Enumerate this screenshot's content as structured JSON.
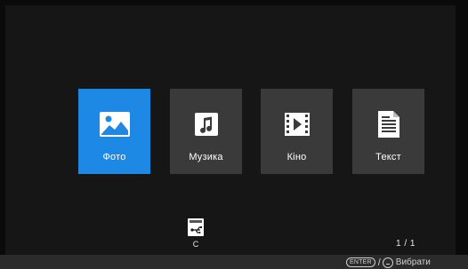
{
  "menu": {
    "items": [
      {
        "label": "Фото",
        "icon": "photo-icon",
        "selected": true
      },
      {
        "label": "Музика",
        "icon": "music-note-icon",
        "selected": false
      },
      {
        "label": "Кіно",
        "icon": "film-play-icon",
        "selected": false
      },
      {
        "label": "Текст",
        "icon": "document-text-icon",
        "selected": false
      }
    ]
  },
  "device": {
    "label": "C",
    "icon": "usb-drive-icon"
  },
  "pager": {
    "text": "1 / 1"
  },
  "hints": {
    "enter_key": "ENTER",
    "separator": "/",
    "select_label": "Вибрати"
  },
  "colors": {
    "selected": "#1e88e5",
    "tile": "#3a3a3a",
    "background": "#161616"
  }
}
